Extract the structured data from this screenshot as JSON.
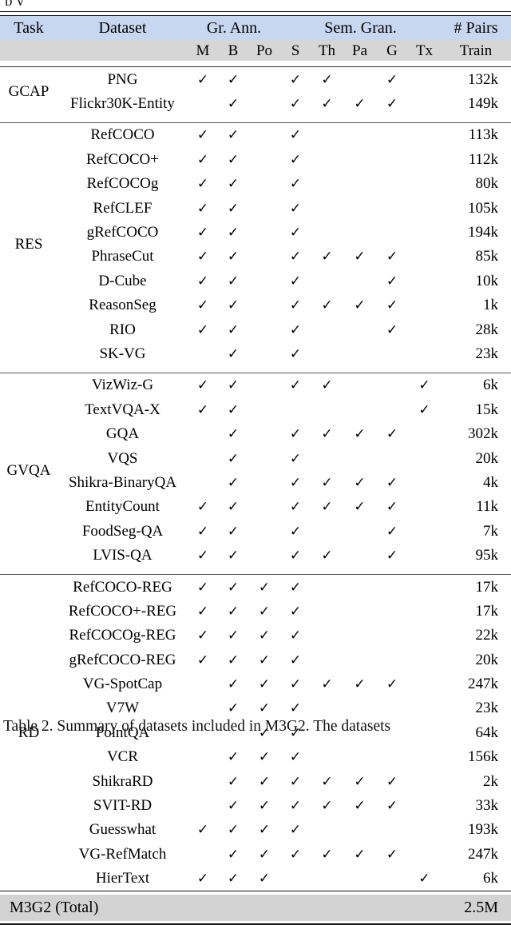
{
  "clipped_top_text": "p     y",
  "table": {
    "header_groups": [
      {
        "label": "Task",
        "span": 1
      },
      {
        "label": "Dataset",
        "span": 1
      },
      {
        "label": "Gr. Ann.",
        "span": 3
      },
      {
        "label": "Sem. Gran.",
        "span": 5
      },
      {
        "label": "# Pairs",
        "span": 1
      }
    ],
    "sub_headers": [
      "",
      "",
      "M",
      "B",
      "Po",
      "S",
      "Th",
      "Pa",
      "G",
      "Tx",
      "Train"
    ],
    "check_glyph": "✓",
    "sections": [
      {
        "task": "GCAP",
        "rows": [
          {
            "dataset": "PNG",
            "marks": [
              "M",
              "B",
              "S",
              "Th",
              "G"
            ],
            "pairs": "132k"
          },
          {
            "dataset": "Flickr30K-Entity",
            "marks": [
              "B",
              "S",
              "Th",
              "Pa",
              "G"
            ],
            "pairs": "149k"
          }
        ]
      },
      {
        "task": "RES",
        "rows": [
          {
            "dataset": "RefCOCO",
            "marks": [
              "M",
              "B",
              "S"
            ],
            "pairs": "113k"
          },
          {
            "dataset": "RefCOCO+",
            "marks": [
              "M",
              "B",
              "S"
            ],
            "pairs": "112k"
          },
          {
            "dataset": "RefCOCOg",
            "marks": [
              "M",
              "B",
              "S"
            ],
            "pairs": "80k"
          },
          {
            "dataset": "RefCLEF",
            "marks": [
              "M",
              "B",
              "S"
            ],
            "pairs": "105k"
          },
          {
            "dataset": "gRefCOCO",
            "marks": [
              "M",
              "B",
              "S"
            ],
            "pairs": "194k"
          },
          {
            "dataset": "PhraseCut",
            "marks": [
              "M",
              "B",
              "S",
              "Th",
              "Pa",
              "G"
            ],
            "pairs": "85k"
          },
          {
            "dataset": "D-Cube",
            "marks": [
              "M",
              "B",
              "S",
              "G"
            ],
            "pairs": "10k"
          },
          {
            "dataset": "ReasonSeg",
            "marks": [
              "M",
              "B",
              "S",
              "Th",
              "Pa",
              "G"
            ],
            "pairs": "1k"
          },
          {
            "dataset": "RIO",
            "marks": [
              "M",
              "B",
              "S",
              "G"
            ],
            "pairs": "28k"
          },
          {
            "dataset": "SK-VG",
            "marks": [
              "B",
              "S"
            ],
            "pairs": "23k"
          }
        ]
      },
      {
        "task": "GVQA",
        "rows": [
          {
            "dataset": "VizWiz-G",
            "marks": [
              "M",
              "B",
              "S",
              "Th",
              "Tx"
            ],
            "pairs": "6k"
          },
          {
            "dataset": "TextVQA-X",
            "marks": [
              "M",
              "B",
              "Tx"
            ],
            "pairs": "15k"
          },
          {
            "dataset": "GQA",
            "marks": [
              "B",
              "S",
              "Th",
              "Pa",
              "G"
            ],
            "pairs": "302k"
          },
          {
            "dataset": "VQS",
            "marks": [
              "B",
              "S"
            ],
            "pairs": "20k"
          },
          {
            "dataset": "Shikra-BinaryQA",
            "marks": [
              "B",
              "S",
              "Th",
              "Pa",
              "G"
            ],
            "pairs": "4k"
          },
          {
            "dataset": "EntityCount",
            "marks": [
              "M",
              "B",
              "S",
              "Th",
              "Pa",
              "G"
            ],
            "pairs": "11k"
          },
          {
            "dataset": "FoodSeg-QA",
            "marks": [
              "M",
              "B",
              "S",
              "G"
            ],
            "pairs": "7k"
          },
          {
            "dataset": "LVIS-QA",
            "marks": [
              "M",
              "B",
              "S",
              "Th",
              "G"
            ],
            "pairs": "95k"
          }
        ]
      },
      {
        "task": "RD",
        "rows": [
          {
            "dataset": "RefCOCO-REG",
            "marks": [
              "M",
              "B",
              "Po",
              "S"
            ],
            "pairs": "17k"
          },
          {
            "dataset": "RefCOCO+-REG",
            "marks": [
              "M",
              "B",
              "Po",
              "S"
            ],
            "pairs": "17k"
          },
          {
            "dataset": "RefCOCOg-REG",
            "marks": [
              "M",
              "B",
              "Po",
              "S"
            ],
            "pairs": "22k"
          },
          {
            "dataset": "gRefCOCO-REG",
            "marks": [
              "M",
              "B",
              "Po",
              "S"
            ],
            "pairs": "20k"
          },
          {
            "dataset": "VG-SpotCap",
            "marks": [
              "B",
              "Po",
              "S",
              "Th",
              "Pa",
              "G"
            ],
            "pairs": "247k"
          },
          {
            "dataset": "V7W",
            "marks": [
              "B",
              "Po",
              "S"
            ],
            "pairs": "23k"
          },
          {
            "dataset": "PointQA",
            "marks": [
              "Po",
              "S"
            ],
            "pairs": "64k"
          },
          {
            "dataset": "VCR",
            "marks": [
              "B",
              "Po",
              "S"
            ],
            "pairs": "156k"
          },
          {
            "dataset": "ShikraRD",
            "marks": [
              "B",
              "Po",
              "S",
              "Th",
              "Pa",
              "G"
            ],
            "pairs": "2k"
          },
          {
            "dataset": "SVIT-RD",
            "marks": [
              "B",
              "Po",
              "S",
              "Th",
              "Pa",
              "G"
            ],
            "pairs": "33k"
          },
          {
            "dataset": "Guesswhat",
            "marks": [
              "M",
              "B",
              "Po",
              "S"
            ],
            "pairs": "193k"
          },
          {
            "dataset": "VG-RefMatch",
            "marks": [
              "B",
              "Po",
              "S",
              "Th",
              "Pa",
              "G"
            ],
            "pairs": "247k"
          },
          {
            "dataset": "HierText",
            "marks": [
              "M",
              "B",
              "Po",
              "Tx"
            ],
            "pairs": "6k"
          }
        ]
      }
    ],
    "total_row": {
      "label": "M3G2 (Total)",
      "value": "2.5M"
    }
  },
  "caption": "Table 2.  Summary of datasets included in M3G2.  The datasets"
}
